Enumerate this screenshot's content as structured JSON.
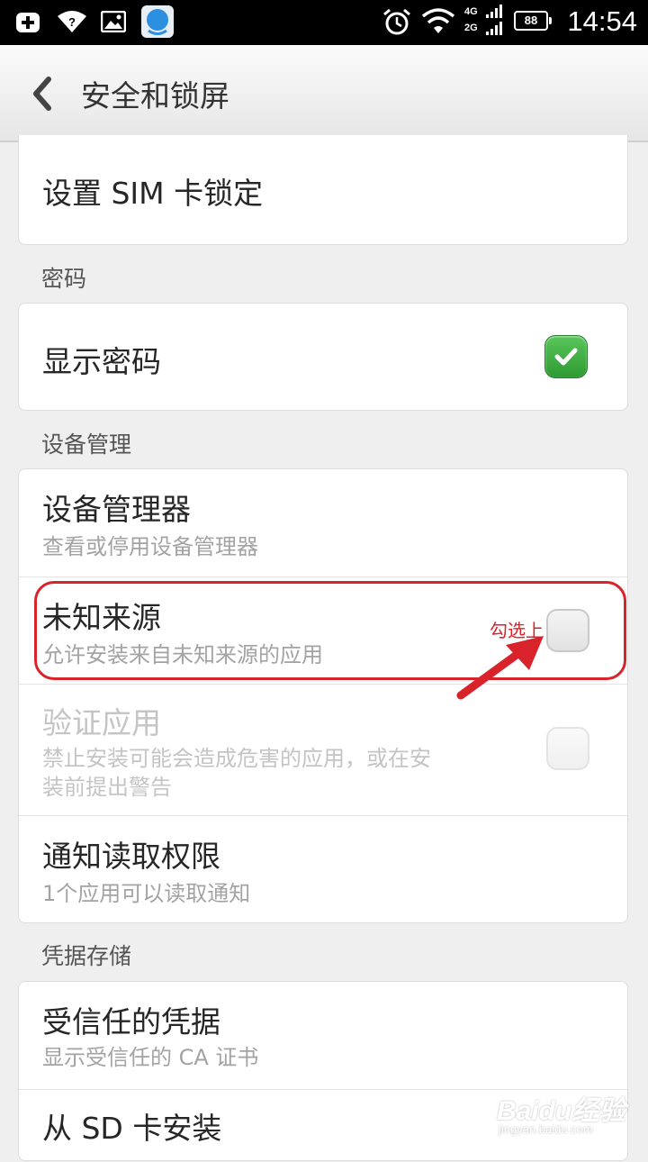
{
  "status_bar": {
    "time": "14:54",
    "battery": "88",
    "network_top": "4G",
    "network_bottom": "2G"
  },
  "header": {
    "title": "安全和锁屏"
  },
  "sections": {
    "sim": {
      "title": "设置 SIM 卡锁定"
    },
    "password_label": "密码",
    "show_password": {
      "title": "显示密码",
      "checked": true
    },
    "device_label": "设备管理",
    "device_admin": {
      "title": "设备管理器",
      "subtitle": "查看或停用设备管理器"
    },
    "unknown_sources": {
      "title": "未知来源",
      "subtitle": "允许安装来自未知来源的应用",
      "checked": false
    },
    "verify_apps": {
      "title": "验证应用",
      "subtitle_line1": "禁止安装可能会造成危害的应用，或在安",
      "subtitle_line2": "装前提出警告",
      "checked": false,
      "enabled": false
    },
    "notification_access": {
      "title": "通知读取权限",
      "subtitle": "1个应用可以读取通知"
    },
    "credential_label": "凭据存储",
    "trusted_creds": {
      "title": "受信任的凭据",
      "subtitle": "显示受信任的 CA 证书"
    },
    "install_sd": {
      "title": "从 SD 卡安装"
    }
  },
  "annotation": {
    "text": "勾选上",
    "color": "#d8232a"
  },
  "watermark": {
    "logo": "Baidu经验",
    "url": "jingyan.baidu.com"
  },
  "colors": {
    "accent_green": "#3fae42",
    "annotation_red": "#d8232a"
  }
}
